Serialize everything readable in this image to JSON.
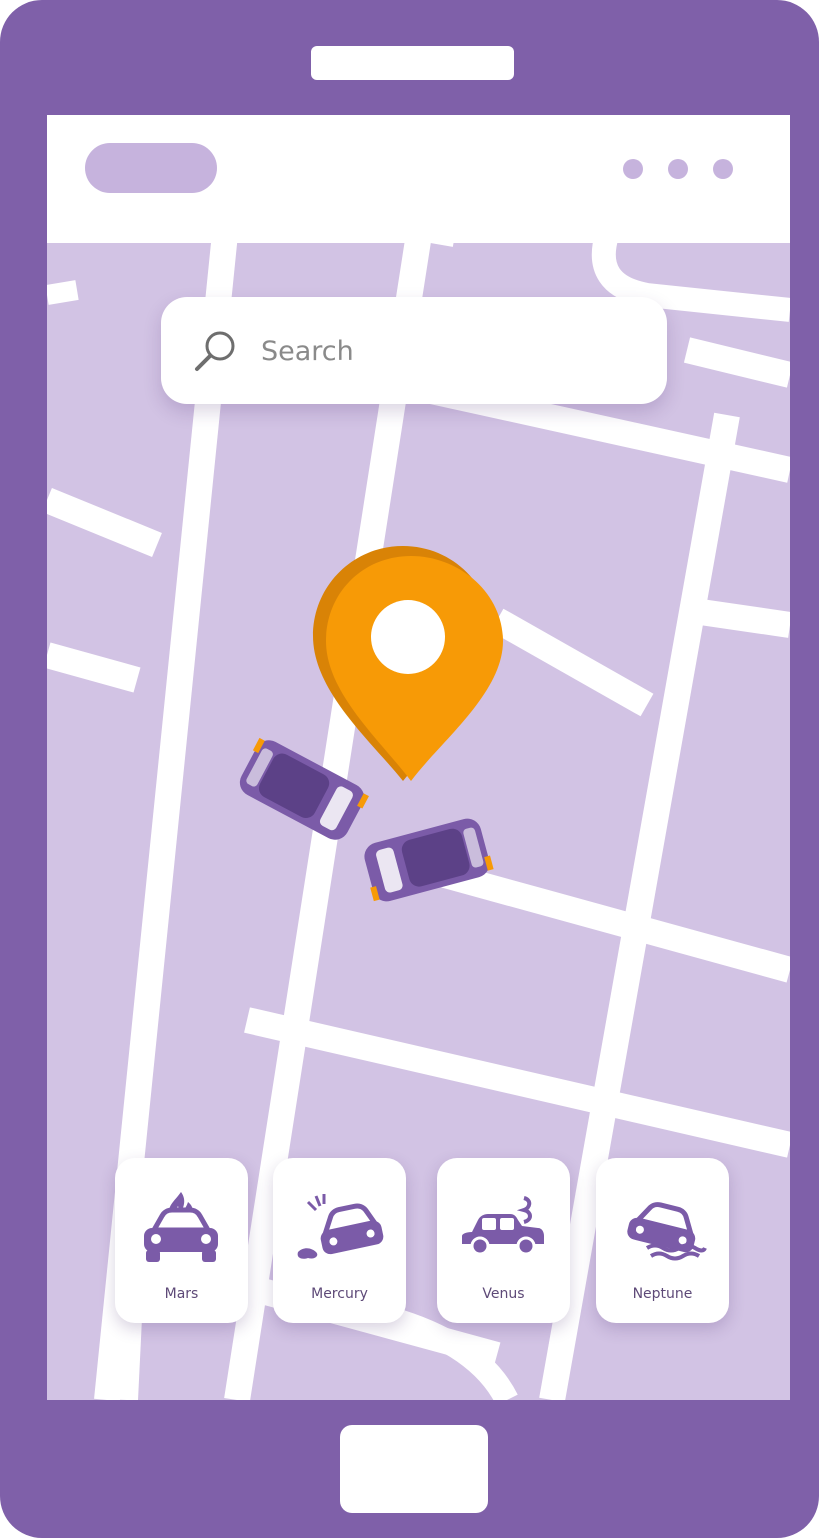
{
  "colors": {
    "phone_body": "#7f60a9",
    "map_block": "#d2c3e4",
    "road": "#ffffff",
    "accent_pin": "#f79a06",
    "car": "#7b5ba8"
  },
  "search": {
    "placeholder": "Search",
    "icon": "search-icon"
  },
  "map_pin": {
    "icon": "location-pin-icon"
  },
  "crash_scene": {
    "icon": "car-crash-icon"
  },
  "categories": [
    {
      "label": "Mars",
      "icon": "car-fire-icon"
    },
    {
      "label": "Mercury",
      "icon": "car-accident-icon"
    },
    {
      "label": "Venus",
      "icon": "car-smoke-icon"
    },
    {
      "label": "Neptune",
      "icon": "car-flood-icon"
    }
  ]
}
